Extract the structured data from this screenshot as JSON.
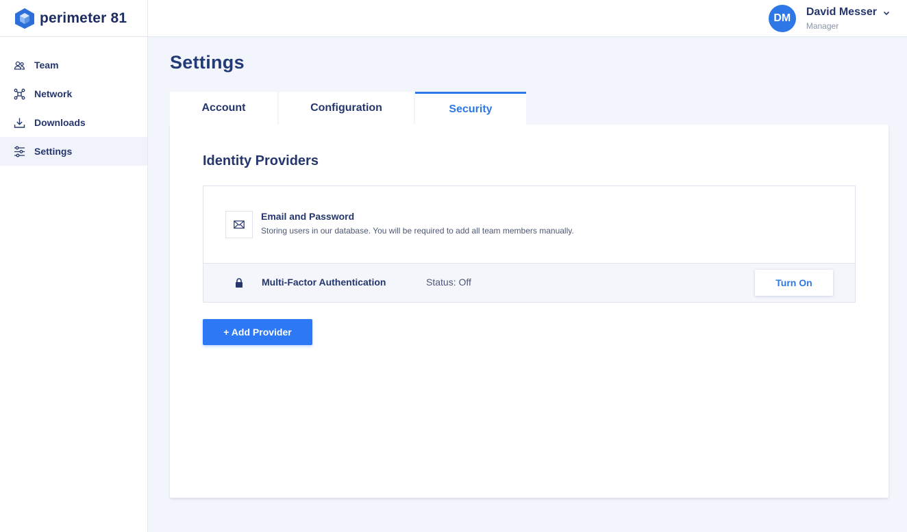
{
  "brand": {
    "name": "perimeter 81"
  },
  "sidebar": {
    "items": [
      {
        "label": "Team",
        "icon": "team-icon"
      },
      {
        "label": "Network",
        "icon": "network-icon"
      },
      {
        "label": "Downloads",
        "icon": "download-icon"
      },
      {
        "label": "Settings",
        "icon": "settings-sliders-icon",
        "active": true
      }
    ]
  },
  "user": {
    "initials": "DM",
    "name": "David Messer",
    "role": "Manager"
  },
  "page": {
    "title": "Settings",
    "tabs": [
      {
        "label": "Account"
      },
      {
        "label": "Configuration"
      },
      {
        "label": "Security",
        "active": true
      }
    ]
  },
  "identity": {
    "title": "Identity Providers",
    "email_provider": {
      "title": "Email and Password",
      "description": "Storing users in our database. You will be required to add all team members manually."
    },
    "mfa": {
      "title": "Multi-Factor Authentication",
      "status": "Status: Off",
      "button": "Turn On"
    },
    "add_button": "+ Add Provider"
  },
  "colors": {
    "accent": "#2d78e6",
    "primary_text": "#24366b",
    "button": "#2d78f5"
  }
}
